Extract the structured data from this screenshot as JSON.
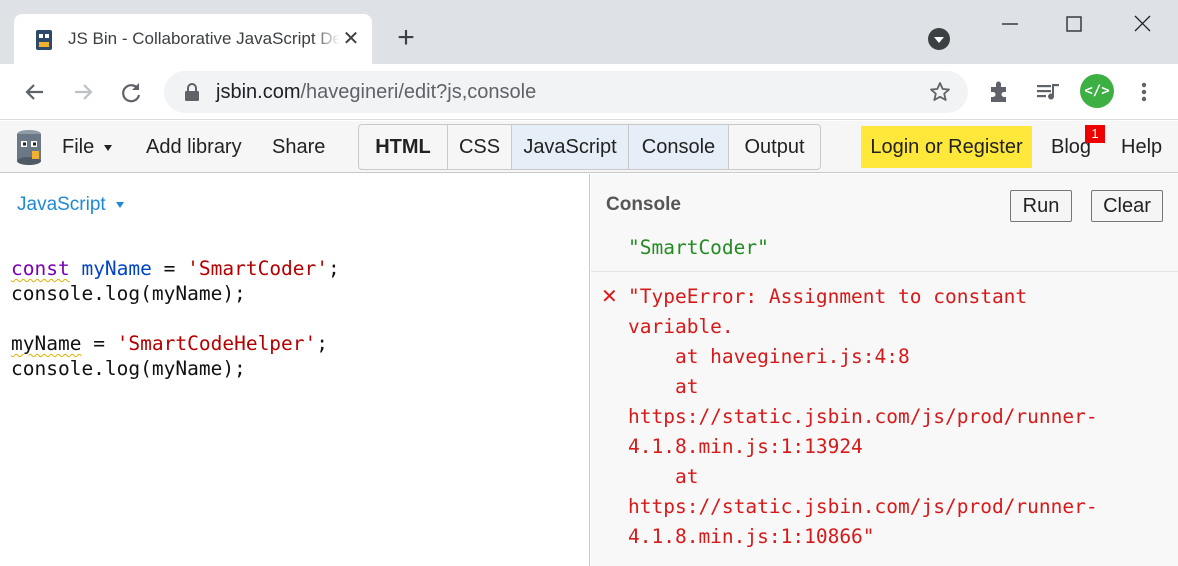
{
  "browser": {
    "tab_title": "JS Bin - Collaborative JavaScript Debugging",
    "url_host": "jsbin.com",
    "url_path": "/havegineri/edit?js,console",
    "extension_label": "</>",
    "icons": [
      "back-icon",
      "forward-icon",
      "reload-icon",
      "lock-icon",
      "star-icon",
      "puzzle-icon",
      "media-icon",
      "kebab-icon"
    ]
  },
  "jsbin": {
    "file_label": "File",
    "add_library_label": "Add library",
    "share_label": "Share",
    "panels": [
      "HTML",
      "CSS",
      "JavaScript",
      "Console",
      "Output"
    ],
    "active_panels": [
      "JavaScript",
      "Console"
    ],
    "login_label": "Login or Register",
    "blog_label": "Blog",
    "blog_badge": "1",
    "help_label": "Help"
  },
  "editor": {
    "language_label": "JavaScript",
    "code": {
      "l1_kw": "const",
      "l1_var": "myName",
      "l1_eq": " = ",
      "l1_str": "'SmartCoder'",
      "l1_end": ";",
      "l2": "console.log(myName);",
      "l4_var": "myName",
      "l4_eq": " = ",
      "l4_str": "'SmartCodeHelper'",
      "l4_end": ";",
      "l5": "console.log(myName);"
    }
  },
  "console": {
    "title": "Console",
    "run_label": "Run",
    "clear_label": "Clear",
    "log_output": "\"SmartCoder\"",
    "error_mark": "✕",
    "error_output": "\"TypeError: Assignment to constant\nvariable.\n    at havegineri.js:4:8\n    at\nhttps://static.jsbin.com/js/prod/runner-\n4.1.8.min.js:1:13924\n    at\nhttps://static.jsbin.com/js/prod/runner-\n4.1.8.min.js:1:10866\""
  },
  "colors": {
    "login_bg": "#ffe83a",
    "active_panel_bg": "#e6eef8",
    "error_red": "#d61a1a",
    "log_green": "#228b22",
    "link_blue": "#1e8ad6"
  }
}
